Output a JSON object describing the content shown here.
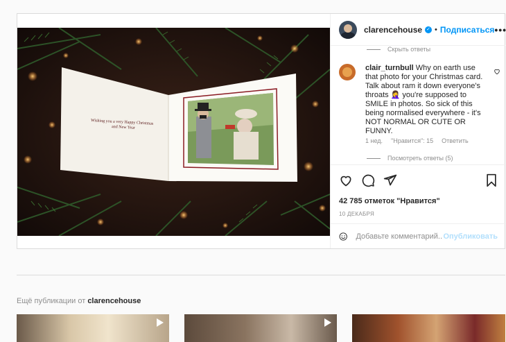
{
  "post": {
    "username": "clarencehouse",
    "follow_label": "Подписаться",
    "more_label": "•••",
    "card_text_line1": "Wishing you a very Happy Christmas",
    "card_text_line2": "and New Year"
  },
  "comments": {
    "hide_replies": "Скрыть ответы",
    "items": [
      {
        "username": "clair_turnbull",
        "text": "Why on earth use that photo for your Christmas card. Talk about ram it down everyone's throats 🤦‍♀️ you're supposed to SMILE in photos. So sick of this being normalised everywhere - it's NOT NORMAL OR CUTE OR FUNNY.",
        "time": "1 нед.",
        "likes": "\"Нравится\": 15",
        "reply_label": "Ответить"
      }
    ],
    "view_replies": "Посмотреть ответы (5)"
  },
  "actions": {
    "likes_text": "42 785 отметок \"Нравится\"",
    "date": "10 ДЕКАБРЯ"
  },
  "add_comment": {
    "placeholder": "Добавьте комментарий...",
    "publish_label": "Опубликовать"
  },
  "more_posts": {
    "prefix": "Ещё публикации от",
    "username": "clarencehouse"
  },
  "colors": {
    "accent": "#0095f6",
    "accent_disabled": "#b2dffc",
    "muted": "#8e8e8e",
    "border": "#dbdbdb"
  },
  "icons": [
    "verified-icon",
    "heart-icon",
    "comment-icon",
    "share-icon",
    "bookmark-icon",
    "emoji-icon",
    "play-icon",
    "more-icon"
  ]
}
